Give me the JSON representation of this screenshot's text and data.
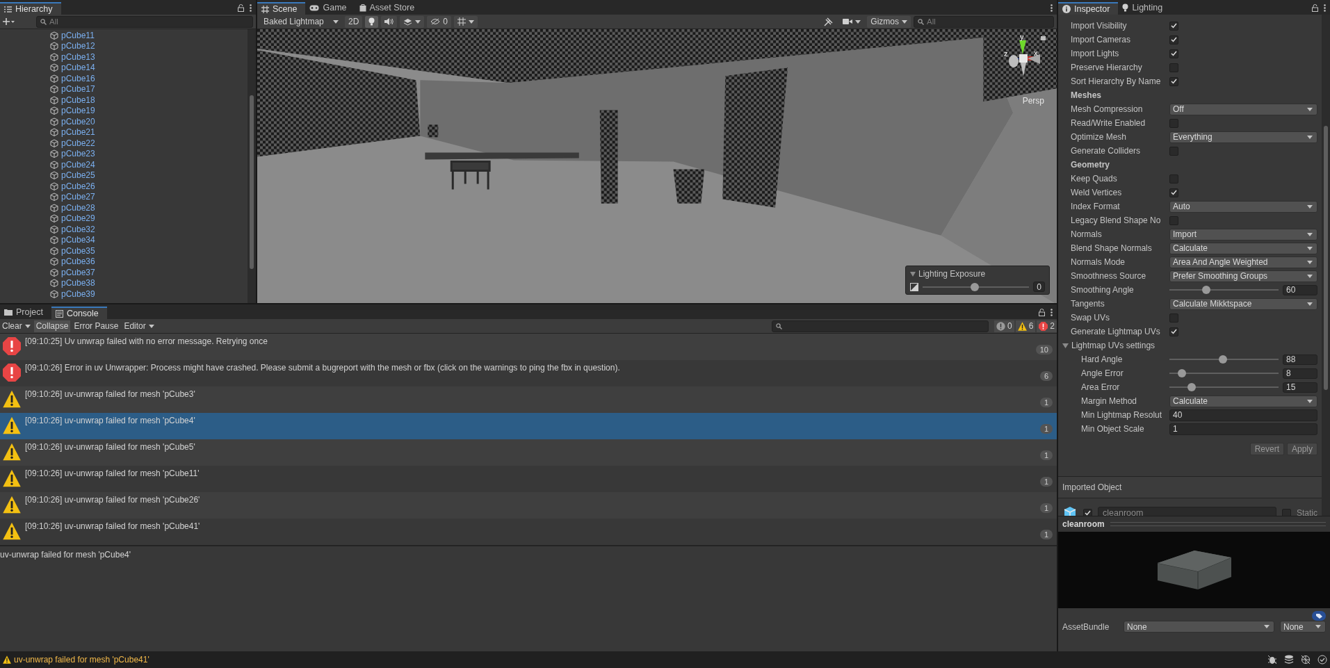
{
  "hierarchy": {
    "title": "Hierarchy",
    "search_placeholder": "All",
    "items": [
      "pCube11",
      "pCube12",
      "pCube13",
      "pCube14",
      "pCube16",
      "pCube17",
      "pCube18",
      "pCube19",
      "pCube20",
      "pCube21",
      "pCube22",
      "pCube23",
      "pCube24",
      "pCube25",
      "pCube26",
      "pCube27",
      "pCube28",
      "pCube29",
      "pCube32",
      "pCube34",
      "pCube35",
      "pCube36",
      "pCube37",
      "pCube38",
      "pCube39"
    ]
  },
  "scene_tabs": [
    {
      "label": "Scene",
      "kind": "scene",
      "selected": true
    },
    {
      "label": "Game",
      "kind": "game",
      "selected": false
    },
    {
      "label": "Asset Store",
      "kind": "store",
      "selected": false
    }
  ],
  "scene_toolbar": {
    "draw_mode": "Baked Lightmap",
    "mode_2d": "2D",
    "lighting_on": true,
    "hidden_count": "0",
    "gizmos": "Gizmos",
    "search_placeholder": "All"
  },
  "scene_view": {
    "axis_labels": {
      "y": "y",
      "x": "x",
      "z": "z"
    },
    "projection": "Persp",
    "lighting_exposure": {
      "title": "Lighting Exposure",
      "level": 0.49,
      "value": "0"
    }
  },
  "console_tabs": [
    {
      "label": "Project",
      "kind": "folder",
      "selected": false
    },
    {
      "label": "Console",
      "kind": "console",
      "selected": true
    }
  ],
  "console_toolbar": {
    "buttons": [
      {
        "label": "Clear",
        "on": false,
        "dropdown": true
      },
      {
        "label": "Collapse",
        "on": true,
        "dropdown": false
      },
      {
        "label": "Error Pause",
        "on": false,
        "dropdown": false
      },
      {
        "label": "Editor",
        "on": false,
        "dropdown": true
      }
    ],
    "counts": [
      {
        "kind": "info",
        "count": "0"
      },
      {
        "kind": "warning",
        "count": "6"
      },
      {
        "kind": "error",
        "count": "2"
      }
    ]
  },
  "console_entries": [
    {
      "kind": "error",
      "message": "[09:10:25] Uv unwrap failed with no error message. Retrying once",
      "count": "10",
      "selected": false
    },
    {
      "kind": "error",
      "message": "[09:10:26] Error in uv Unwrapper: Process might have crashed. Please submit a bugreport with the mesh or fbx (click on the warnings to ping the fbx in question).",
      "count": "6",
      "selected": false
    },
    {
      "kind": "warning",
      "message": "[09:10:26] uv-unwrap failed for mesh 'pCube3'",
      "count": "1",
      "selected": false
    },
    {
      "kind": "warning",
      "message": "[09:10:26] uv-unwrap failed for mesh 'pCube4'",
      "count": "1",
      "selected": true
    },
    {
      "kind": "warning",
      "message": "[09:10:26] uv-unwrap failed for mesh 'pCube5'",
      "count": "1",
      "selected": false
    },
    {
      "kind": "warning",
      "message": "[09:10:26] uv-unwrap failed for mesh 'pCube11'",
      "count": "1",
      "selected": false
    },
    {
      "kind": "warning",
      "message": "[09:10:26] uv-unwrap failed for mesh 'pCube26'",
      "count": "1",
      "selected": false
    },
    {
      "kind": "warning",
      "message": "[09:10:26] uv-unwrap failed for mesh 'pCube41'",
      "count": "1",
      "selected": false
    }
  ],
  "console_detail": "uv-unwrap failed for mesh 'pCube4'",
  "inspector_tabs": [
    {
      "label": "Inspector",
      "kind": "info",
      "selected": true
    },
    {
      "label": "Lighting",
      "kind": "light",
      "selected": false
    }
  ],
  "inspector_rows": [
    {
      "kind": "checkbox",
      "label": "Import Visibility",
      "checked": true
    },
    {
      "kind": "checkbox",
      "label": "Import Cameras",
      "checked": true
    },
    {
      "kind": "checkbox",
      "label": "Import Lights",
      "checked": true
    },
    {
      "kind": "checkbox",
      "label": "Preserve Hierarchy",
      "checked": false
    },
    {
      "kind": "checkbox",
      "label": "Sort Hierarchy By Name",
      "checked": true
    },
    {
      "kind": "header",
      "label": "Meshes"
    },
    {
      "kind": "dropdown",
      "label": "Mesh Compression",
      "value": "Off"
    },
    {
      "kind": "checkbox",
      "label": "Read/Write Enabled",
      "checked": false
    },
    {
      "kind": "dropdown",
      "label": "Optimize Mesh",
      "value": "Everything"
    },
    {
      "kind": "checkbox",
      "label": "Generate Colliders",
      "checked": false
    },
    {
      "kind": "header",
      "label": "Geometry"
    },
    {
      "kind": "checkbox",
      "label": "Keep Quads",
      "checked": false
    },
    {
      "kind": "checkbox",
      "label": "Weld Vertices",
      "checked": true
    },
    {
      "kind": "dropdown",
      "label": "Index Format",
      "value": "Auto"
    },
    {
      "kind": "checkbox",
      "label": "Legacy Blend Shape No",
      "checked": false
    },
    {
      "kind": "dropdown",
      "label": "Normals",
      "value": "Import"
    },
    {
      "kind": "dropdown",
      "label": "Blend Shape Normals",
      "value": "Calculate"
    },
    {
      "kind": "dropdown",
      "label": "Normals Mode",
      "value": "Area And Angle Weighted"
    },
    {
      "kind": "dropdown",
      "label": "Smoothness Source",
      "value": "Prefer Smoothing Groups"
    },
    {
      "kind": "slider",
      "label": "Smoothing Angle",
      "level": 0.34,
      "value": "60"
    },
    {
      "kind": "dropdown",
      "label": "Tangents",
      "value": "Calculate Mikktspace"
    },
    {
      "kind": "checkbox",
      "label": "Swap UVs",
      "checked": false
    },
    {
      "kind": "checkbox",
      "label": "Generate Lightmap UVs",
      "checked": true
    },
    {
      "kind": "foldout",
      "label": "Lightmap UVs settings",
      "expanded": true,
      "children": [
        {
          "kind": "slider",
          "label": "Hard Angle",
          "level": 0.49,
          "value": "88"
        },
        {
          "kind": "slider",
          "label": "Angle Error",
          "level": 0.115,
          "value": "8"
        },
        {
          "kind": "slider",
          "label": "Area Error",
          "level": 0.205,
          "value": "15"
        },
        {
          "kind": "dropdown",
          "label": "Margin Method",
          "value": "Calculate"
        },
        {
          "kind": "field",
          "label": "Min Lightmap Resolut",
          "value": "40"
        },
        {
          "kind": "field",
          "label": "Min Object Scale",
          "value": "1"
        }
      ]
    }
  ],
  "inspector_buttons": [
    "Revert",
    "Apply"
  ],
  "imported_object": {
    "title": "Imported Object",
    "active": true,
    "name": "cleanroom",
    "static": false,
    "static_label": "Static"
  },
  "preview": {
    "title": "cleanroom"
  },
  "asset_bundle": {
    "label": "AssetBundle",
    "name": "None",
    "variant": "None"
  },
  "status_bar": {
    "kind": "warning",
    "message": "uv-unwrap failed for mesh 'pCube41'"
  }
}
